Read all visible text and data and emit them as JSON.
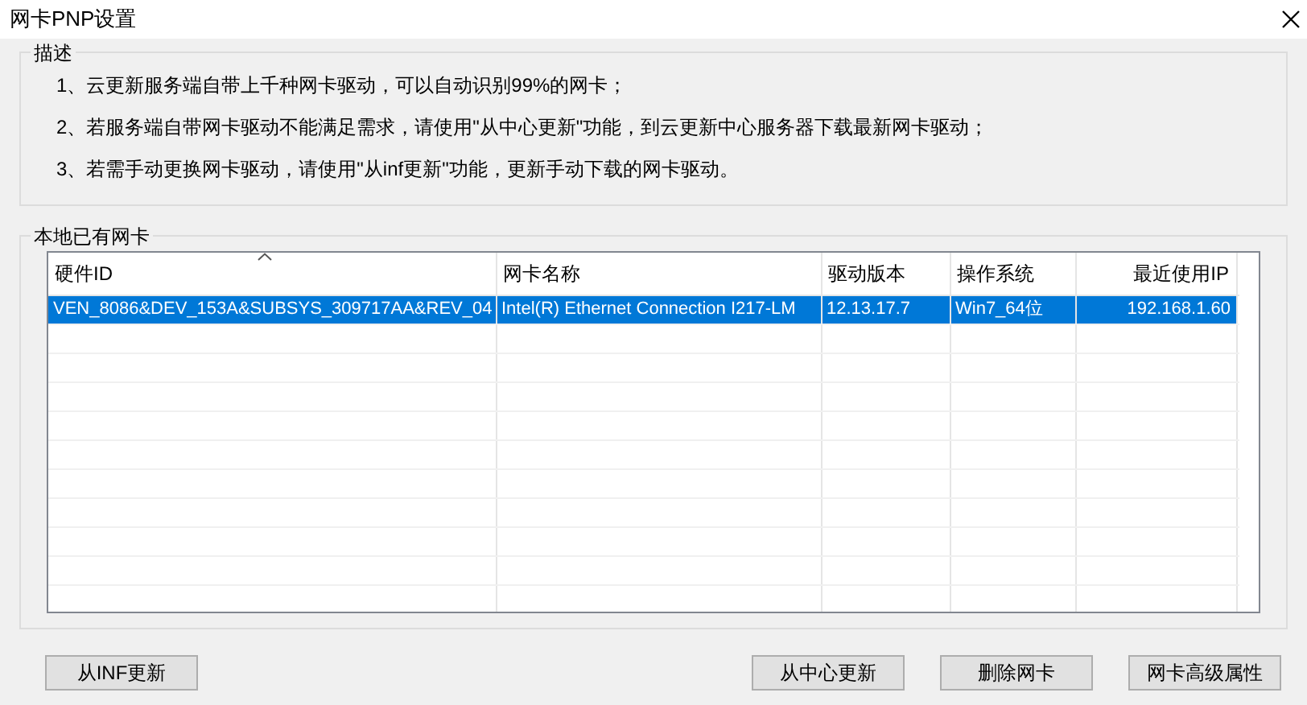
{
  "window": {
    "title": "网卡PNP设置"
  },
  "description": {
    "title": "描述",
    "lines": [
      "1、云更新服务端自带上千种网卡驱动，可以自动识别99%的网卡；",
      "2、若服务端自带网卡驱动不能满足需求，请使用\"从中心更新\"功能，到云更新中心服务器下载最新网卡驱动；",
      "3、若需手动更换网卡驱动，请使用\"从inf更新\"功能，更新手动下载的网卡驱动。"
    ]
  },
  "local_cards": {
    "title": "本地已有网卡",
    "table": {
      "columns": [
        {
          "label": "硬件ID",
          "sorted": true
        },
        {
          "label": "网卡名称",
          "sorted": false
        },
        {
          "label": "驱动版本",
          "sorted": false
        },
        {
          "label": "操作系统",
          "sorted": false
        },
        {
          "label": "最近使用IP",
          "sorted": false
        }
      ],
      "rows": [
        {
          "selected": true,
          "cells": [
            "VEN_8086&DEV_153A&SUBSYS_309717AA&REV_04",
            "Intel(R) Ethernet Connection I217-LM",
            "12.13.17.7",
            "Win7_64位",
            "192.168.1.60"
          ]
        }
      ]
    }
  },
  "buttons": [
    {
      "label": "从INF更新"
    },
    {
      "label": "从中心更新"
    },
    {
      "label": "删除网卡"
    },
    {
      "label": "网卡高级属性"
    }
  ]
}
